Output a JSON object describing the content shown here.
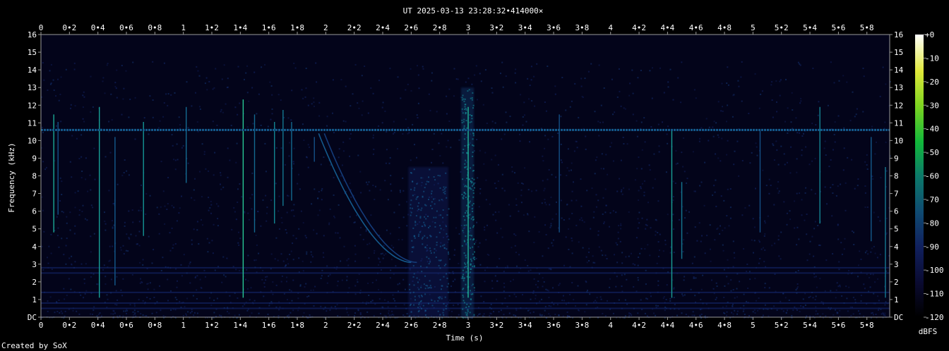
{
  "chart_data": {
    "type": "heatmap",
    "title": "UT 2025-03-13 23:28:32•414000×",
    "xlabel": "Time (s)",
    "ylabel": "Frequency (kHz)",
    "xlim": [
      0,
      5.96
    ],
    "ylim": [
      0,
      16
    ],
    "x_ticks": [
      "0",
      "0•2",
      "0•4",
      "0•6",
      "0•8",
      "1",
      "1•2",
      "1•4",
      "1•6",
      "1•8",
      "2",
      "2•2",
      "2•4",
      "2•6",
      "2•8",
      "3",
      "3•2",
      "3•4",
      "3•6",
      "3•8",
      "4",
      "4•2",
      "4•4",
      "4•6",
      "4•8",
      "5",
      "5•2",
      "5•4",
      "5•6",
      "5•8"
    ],
    "x_tick_values": [
      0,
      0.2,
      0.4,
      0.6,
      0.8,
      1.0,
      1.2,
      1.4,
      1.6,
      1.8,
      2.0,
      2.2,
      2.4,
      2.6,
      2.8,
      3.0,
      3.2,
      3.4,
      3.6,
      3.8,
      4.0,
      4.2,
      4.4,
      4.6,
      4.8,
      5.0,
      5.2,
      5.4,
      5.6,
      5.8
    ],
    "y_ticks": [
      "DC",
      "1",
      "2",
      "3",
      "4",
      "5",
      "6",
      "7",
      "8",
      "9",
      "10",
      "11",
      "12",
      "13",
      "14",
      "15",
      "16"
    ],
    "colorbar": {
      "label": "dBFS",
      "ticks": [
        "+0",
        "-10",
        "-20",
        "-30",
        "-40",
        "-50",
        "-60",
        "-70",
        "-80",
        "-90",
        "-100",
        "-110",
        "-120"
      ],
      "range": [
        -120,
        0
      ]
    },
    "features": {
      "constant_tone_khz": 10.6,
      "low_bands_khz": [
        0.5,
        0.8,
        1.4,
        2.5,
        2.8
      ],
      "impulses": [
        {
          "t": 0.09,
          "f_top_khz": 13.5,
          "f_bottom_khz": 4.0,
          "level": 0.65
        },
        {
          "t": 0.12,
          "f_top_khz": 13.0,
          "f_bottom_khz": 5.0,
          "level": 0.3
        },
        {
          "t": 0.41,
          "f_top_khz": 14.0,
          "f_bottom_khz": 0.0,
          "level": 0.6
        },
        {
          "t": 0.52,
          "f_top_khz": 12.0,
          "f_bottom_khz": 1.0,
          "level": 0.35
        },
        {
          "t": 0.72,
          "f_top_khz": 13.0,
          "f_bottom_khz": 3.8,
          "level": 0.55
        },
        {
          "t": 1.02,
          "f_top_khz": 14.0,
          "f_bottom_khz": 6.8,
          "level": 0.4
        },
        {
          "t": 1.42,
          "f_top_khz": 14.5,
          "f_bottom_khz": 0.2,
          "level": 0.85
        },
        {
          "t": 1.5,
          "f_top_khz": 13.5,
          "f_bottom_khz": 4.0,
          "level": 0.4
        },
        {
          "t": 1.64,
          "f_top_khz": 13.0,
          "f_bottom_khz": 4.5,
          "level": 0.5
        },
        {
          "t": 1.7,
          "f_top_khz": 13.8,
          "f_bottom_khz": 5.5,
          "level": 0.45
        },
        {
          "t": 1.76,
          "f_top_khz": 13.0,
          "f_bottom_khz": 5.8,
          "level": 0.4
        },
        {
          "t": 1.92,
          "f_top_khz": 12.0,
          "f_bottom_khz": 8.0,
          "level": 0.3
        },
        {
          "t": 3.0,
          "f_top_khz": 14.0,
          "f_bottom_khz": 0.0,
          "level": 0.7
        },
        {
          "t": 3.64,
          "f_top_khz": 13.5,
          "f_bottom_khz": 4.0,
          "level": 0.3
        },
        {
          "t": 4.43,
          "f_top_khz": 12.5,
          "f_bottom_khz": 0.3,
          "level": 0.6
        },
        {
          "t": 4.5,
          "f_top_khz": 9.0,
          "f_bottom_khz": 2.5,
          "level": 0.45
        },
        {
          "t": 5.05,
          "f_top_khz": 12.5,
          "f_bottom_khz": 4.0,
          "level": 0.3
        },
        {
          "t": 5.47,
          "f_top_khz": 14.0,
          "f_bottom_khz": 4.5,
          "level": 0.5
        },
        {
          "t": 5.83,
          "f_top_khz": 12.0,
          "f_bottom_khz": 3.5,
          "level": 0.35
        },
        {
          "t": 5.93,
          "f_top_khz": 10.0,
          "f_bottom_khz": 0.0,
          "level": 0.45
        }
      ],
      "sweep": {
        "t_start": 1.95,
        "t_end": 2.6,
        "f_start_khz": 10.4,
        "f_end_khz": 3.1
      },
      "noise_blocks": [
        {
          "t0": 2.58,
          "t1": 2.86,
          "f_top_khz": 8.5,
          "level": 0.3
        },
        {
          "t0": 2.95,
          "t1": 3.04,
          "f_top_khz": 13.0,
          "level": 0.45
        }
      ]
    }
  },
  "footer": {
    "created_by": "Created by SoX"
  }
}
